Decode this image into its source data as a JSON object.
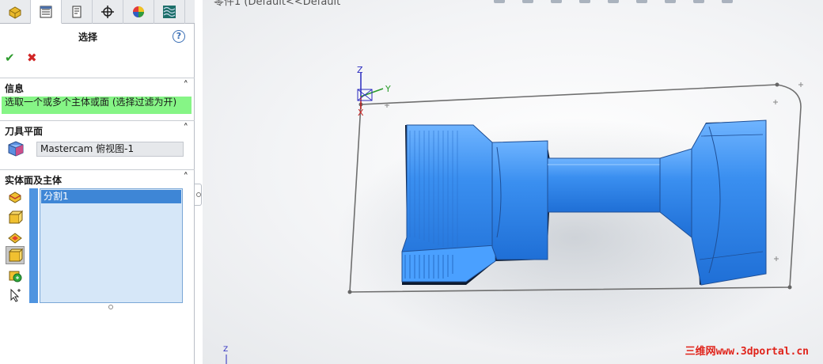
{
  "tabs": [
    {
      "name": "featuremanager-tab",
      "icon": "part-icon"
    },
    {
      "name": "propertymanager-tab",
      "icon": "property-list-icon"
    },
    {
      "name": "configuration-tab",
      "icon": "configuration-icon"
    },
    {
      "name": "dimxpert-tab",
      "icon": "crosshair-icon"
    },
    {
      "name": "display-manager-tab",
      "icon": "appearance-icon"
    },
    {
      "name": "cam-tab",
      "icon": "cam-layers-icon"
    }
  ],
  "header": {
    "title": "选择",
    "help": "?",
    "ok": "✔",
    "cancel": "✖"
  },
  "sections": {
    "info": {
      "title": "信息",
      "message": "选取一个或多个主体或面 (选择过滤为开)",
      "collapse": "˄"
    },
    "tool_plane": {
      "title": "刀具平面",
      "value": "Mastercam 俯视图-1",
      "collapse": "˄"
    },
    "solids": {
      "title": "实体面及主体",
      "collapse": "˄",
      "items": [
        "分割1"
      ]
    }
  },
  "filters": [
    {
      "name": "filter-edges-icon",
      "selected": false
    },
    {
      "name": "filter-solid-bodies-icon",
      "selected": false
    },
    {
      "name": "filter-faces-icon",
      "selected": false
    },
    {
      "name": "filter-bodies-icon",
      "selected": true
    },
    {
      "name": "filter-features-icon",
      "selected": false
    },
    {
      "name": "filter-select-icon",
      "selected": false
    }
  ],
  "viewport": {
    "top_text": "零件1 (Default<<Default",
    "triad": {
      "z": "Z",
      "y": "Y",
      "x": "X"
    },
    "corner_triad": {
      "z": "Z"
    },
    "watermark": "三维网www.3dportal.cn"
  },
  "colors": {
    "part_blue": "#3a8ff0",
    "selection_green": "#86f586",
    "accent_blue": "#3e86d6"
  }
}
